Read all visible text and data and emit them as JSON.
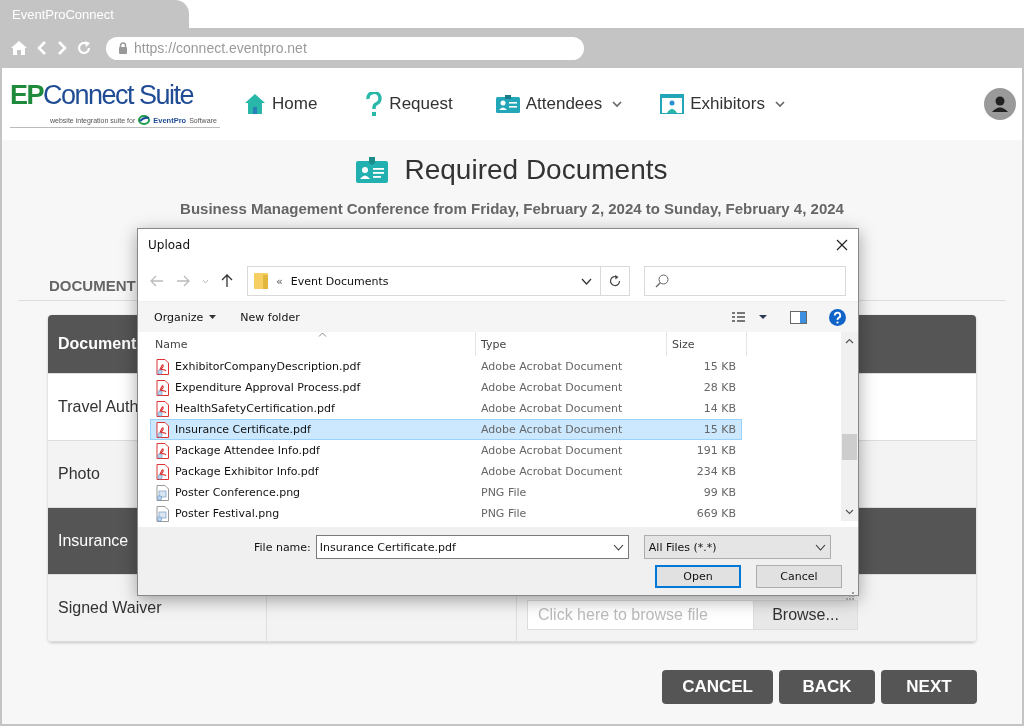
{
  "browser": {
    "tab_title": "EventProConnect",
    "url": "https://connect.eventpro.net"
  },
  "logo": {
    "mark": "EP",
    "name": "Connect Suite",
    "tagline": "website integration suite for",
    "brand": "EventPro",
    "brand_suffix": "Software"
  },
  "nav": [
    {
      "label": "Home",
      "kind": "home",
      "has_menu": false
    },
    {
      "label": "Request",
      "kind": "question",
      "has_menu": false
    },
    {
      "label": "Attendees",
      "kind": "badge",
      "has_menu": true
    },
    {
      "label": "Exhibitors",
      "kind": "booth",
      "has_menu": true
    }
  ],
  "page": {
    "title": "Required Documents",
    "subtitle": "Business Management Conference from Friday, February 2, 2024 to Sunday, February 4, 2024",
    "section_heading": "DOCUMENT"
  },
  "table": {
    "columns": [
      "Document"
    ],
    "rows": [
      {
        "cells": [
          "Travel Auth"
        ],
        "selected": false
      },
      {
        "cells": [
          "Photo"
        ],
        "selected": false
      },
      {
        "cells": [
          "Insurance"
        ],
        "selected": true
      },
      {
        "cells": [
          "Signed Waiver"
        ],
        "selected": false,
        "file_field": {
          "placeholder": "Click here to browse file",
          "button": "Browse..."
        }
      }
    ]
  },
  "actions": [
    "CANCEL",
    "BACK",
    "NEXT"
  ],
  "dialog": {
    "title": "Upload",
    "path_prefix": "«",
    "folder": "Event Documents",
    "toolbar": [
      "Organize",
      "New folder"
    ],
    "columns": [
      "Name",
      "Type",
      "Size"
    ],
    "files": [
      {
        "name": "ExhibitorCompanyDescription.pdf",
        "type": "Adobe Acrobat Document",
        "size": "15 KB",
        "kind": "pdf",
        "selected": false
      },
      {
        "name": "Expenditure Approval Process.pdf",
        "type": "Adobe Acrobat Document",
        "size": "28 KB",
        "kind": "pdf",
        "selected": false
      },
      {
        "name": "HealthSafetyCertification.pdf",
        "type": "Adobe Acrobat Document",
        "size": "14 KB",
        "kind": "pdf",
        "selected": false
      },
      {
        "name": "Insurance Certificate.pdf",
        "type": "Adobe Acrobat Document",
        "size": "15 KB",
        "kind": "pdf",
        "selected": true
      },
      {
        "name": "Package Attendee Info.pdf",
        "type": "Adobe Acrobat Document",
        "size": "191 KB",
        "kind": "pdf",
        "selected": false
      },
      {
        "name": "Package Exhibitor Info.pdf",
        "type": "Adobe Acrobat Document",
        "size": "234 KB",
        "kind": "pdf",
        "selected": false
      },
      {
        "name": "Poster Conference.png",
        "type": "PNG File",
        "size": "99 KB",
        "kind": "image",
        "selected": false
      },
      {
        "name": "Poster Festival.png",
        "type": "PNG File",
        "size": "669 KB",
        "kind": "image",
        "selected": false
      }
    ],
    "file_name_label": "File name:",
    "file_name": "Insurance Certificate.pdf",
    "file_type": "All Files (*.*)",
    "buttons": [
      {
        "label": "Open",
        "default": true
      },
      {
        "label": "Cancel",
        "default": false
      }
    ]
  }
}
